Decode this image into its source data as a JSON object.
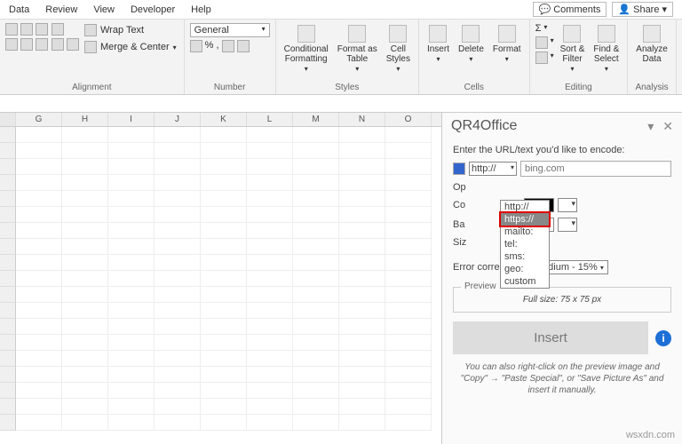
{
  "menu": {
    "data": "Data",
    "review": "Review",
    "view": "View",
    "developer": "Developer",
    "help": "Help"
  },
  "actions": {
    "comments": "Comments",
    "share": "Share"
  },
  "ribbon": {
    "alignment": {
      "wrap": "Wrap Text",
      "merge": "Merge & Center",
      "label": "Alignment"
    },
    "number": {
      "format": "General",
      "label": "Number"
    },
    "styles": {
      "cond": "Conditional\nFormatting",
      "table": "Format as\nTable",
      "cell": "Cell\nStyles",
      "label": "Styles"
    },
    "cells": {
      "insert": "Insert",
      "delete": "Delete",
      "format": "Format",
      "label": "Cells"
    },
    "editing": {
      "sort": "Sort &\nFilter",
      "find": "Find &\nSelect",
      "label": "Editing"
    },
    "analysis": {
      "analyze": "Analyze\nData",
      "label": "Analysis"
    }
  },
  "cols": [
    "G",
    "H",
    "I",
    "J",
    "K",
    "L",
    "M",
    "N",
    "O"
  ],
  "pane": {
    "title": "QR4Office",
    "prompt": "Enter the URL/text you'd like to encode:",
    "proto": "http://",
    "placeholder": "bing.com",
    "opts": [
      "http://",
      "https://",
      "mailto:",
      "tel:",
      "sms:",
      "geo:",
      "custom"
    ],
    "op_lbl": "Op",
    "co_lbl": "Co",
    "ba_lbl": "Ba",
    "siz_lbl": "Siz",
    "err_lbl": "Error correction:",
    "err_val": "Medium - 15%",
    "preview_lbl": "Preview",
    "preview_txt": "Full size: 75 x 75 px",
    "insert": "Insert",
    "hint": "You can also right-click on the preview image and \"Copy\" → \"Paste Special\", or \"Save Picture As\" and insert it manually."
  },
  "watermark": "wsxdn.com"
}
